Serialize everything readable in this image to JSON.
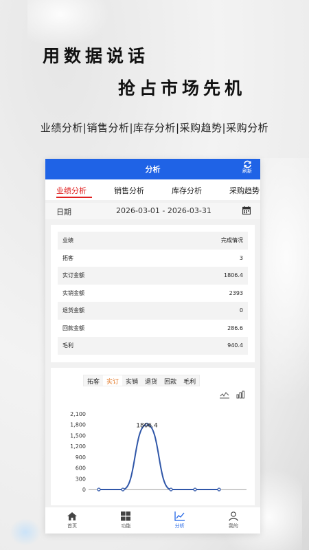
{
  "promo": {
    "slogan_line1": "用数据说话",
    "slogan_line2": "抢占市场先机",
    "features": "业绩分析|销售分析|库存分析|采购趋势|采购分析"
  },
  "appbar": {
    "title": "分析",
    "refresh_label": "刷新",
    "color": "#1f63e6"
  },
  "tabs": [
    {
      "label": "业绩分析",
      "active": true
    },
    {
      "label": "销售分析"
    },
    {
      "label": "库存分析"
    },
    {
      "label": "采购趋势"
    }
  ],
  "date": {
    "label": "日期",
    "range": "2026-03-01 - 2026-03-31"
  },
  "table": {
    "header": {
      "left": "业绩",
      "right": "完成情况"
    },
    "rows": [
      {
        "label": "拓客",
        "value": "3"
      },
      {
        "label": "实订金额",
        "value": "1806.4"
      },
      {
        "label": "实销金额",
        "value": "2393"
      },
      {
        "label": "退货金额",
        "value": "0"
      },
      {
        "label": "回款金额",
        "value": "286.6"
      },
      {
        "label": "毛利",
        "value": "940.4"
      }
    ]
  },
  "subtabs": [
    {
      "label": "拓客"
    },
    {
      "label": "实订",
      "active": true
    },
    {
      "label": "实销"
    },
    {
      "label": "退货"
    },
    {
      "label": "回款"
    },
    {
      "label": "毛利"
    }
  ],
  "chart_data": {
    "type": "line",
    "x": [
      1,
      2,
      3,
      4,
      5,
      6
    ],
    "values": [
      0,
      0,
      1806.4,
      0,
      0,
      0
    ],
    "peak_label": "1806.4",
    "yticks": [
      "2,100",
      "1,800",
      "1,500",
      "1,200",
      "900",
      "600",
      "300",
      "0"
    ],
    "ylim": [
      0,
      2100
    ],
    "line_color": "#2f56a8",
    "smooth": true
  },
  "bottomnav": [
    {
      "label": "首页",
      "icon": "home-icon"
    },
    {
      "label": "功能",
      "icon": "grid-icon"
    },
    {
      "label": "分析",
      "icon": "chart-line-icon",
      "active": true
    },
    {
      "label": "我的",
      "icon": "user-icon"
    }
  ]
}
